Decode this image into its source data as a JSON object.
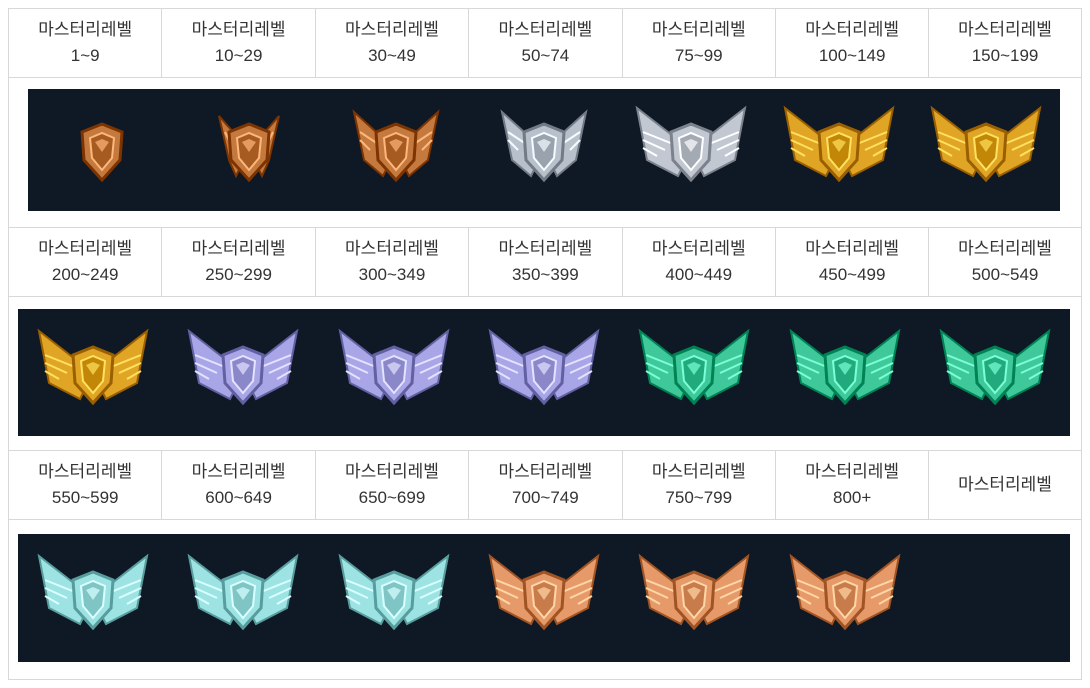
{
  "rows": [
    {
      "labels": [
        {
          "title": "마스터리레벨",
          "range": "1~9"
        },
        {
          "title": "마스터리레벨",
          "range": "10~29"
        },
        {
          "title": "마스터리레벨",
          "range": "30~49"
        },
        {
          "title": "마스터리레벨",
          "range": "50~74"
        },
        {
          "title": "마스터리레벨",
          "range": "75~99"
        },
        {
          "title": "마스터리레벨",
          "range": "100~149"
        },
        {
          "title": "마스터리레벨",
          "range": "150~199"
        }
      ],
      "emblems": [
        {
          "icon": "bronze-small-shield-icon",
          "color": "#c47a3e"
        },
        {
          "icon": "bronze-small-winged-shield-icon",
          "color": "#c47a3e"
        },
        {
          "icon": "bronze-winged-shield-icon",
          "color": "#c47a3e"
        },
        {
          "icon": "silver-winged-shield-icon",
          "color": "#b8c0cc"
        },
        {
          "icon": "silver-wide-winged-shield-icon",
          "color": "#c2c8d2"
        },
        {
          "icon": "gold-winged-shield-icon",
          "color": "#e0a524"
        },
        {
          "icon": "gold-crossed-winged-shield-icon",
          "color": "#e0a524"
        }
      ]
    },
    {
      "labels": [
        {
          "title": "마스터리레벨",
          "range": "200~249"
        },
        {
          "title": "마스터리레벨",
          "range": "250~299"
        },
        {
          "title": "마스터리레벨",
          "range": "300~349"
        },
        {
          "title": "마스터리레벨",
          "range": "350~399"
        },
        {
          "title": "마스터리레벨",
          "range": "400~449"
        },
        {
          "title": "마스터리레벨",
          "range": "450~499"
        },
        {
          "title": "마스터리레벨",
          "range": "500~549"
        }
      ],
      "emblems": [
        {
          "icon": "gold-ornate-winged-shield-icon",
          "color": "#e0a524"
        },
        {
          "icon": "platinum-winged-shield-icon",
          "color": "#a8a6e6"
        },
        {
          "icon": "platinum-crossed-winged-shield-icon",
          "color": "#a8a6e6"
        },
        {
          "icon": "platinum-ornate-winged-shield-icon",
          "color": "#a8a6e6"
        },
        {
          "icon": "emerald-winged-shield-icon",
          "color": "#3fc99a"
        },
        {
          "icon": "emerald-large-winged-shield-icon",
          "color": "#3fc99a"
        },
        {
          "icon": "emerald-wreath-winged-shield-icon",
          "color": "#3fc99a"
        }
      ]
    },
    {
      "labels": [
        {
          "title": "마스터리레벨",
          "range": "550~599"
        },
        {
          "title": "마스터리레벨",
          "range": "600~649"
        },
        {
          "title": "마스터리레벨",
          "range": "650~699"
        },
        {
          "title": "마스터리레벨",
          "range": "700~749"
        },
        {
          "title": "마스터리레벨",
          "range": "750~799"
        },
        {
          "title": "마스터리레벨",
          "range": "800+"
        },
        {
          "title": "마스터리레벨",
          "range": ""
        }
      ],
      "emblems": [
        {
          "icon": "diamond-winged-shield-icon",
          "color": "#9ee3e3"
        },
        {
          "icon": "diamond-bannered-winged-shield-icon",
          "color": "#9ee3e3"
        },
        {
          "icon": "diamond-ornate-winged-shield-icon",
          "color": "#9ee3e3"
        },
        {
          "icon": "rose-gold-scroll-shield-icon",
          "color": "#e69a6a"
        },
        {
          "icon": "rose-gold-crowned-scroll-shield-icon",
          "color": "#e69a6a"
        },
        {
          "icon": "rose-gold-starred-scroll-shield-icon",
          "color": "#e69a6a"
        }
      ]
    }
  ]
}
